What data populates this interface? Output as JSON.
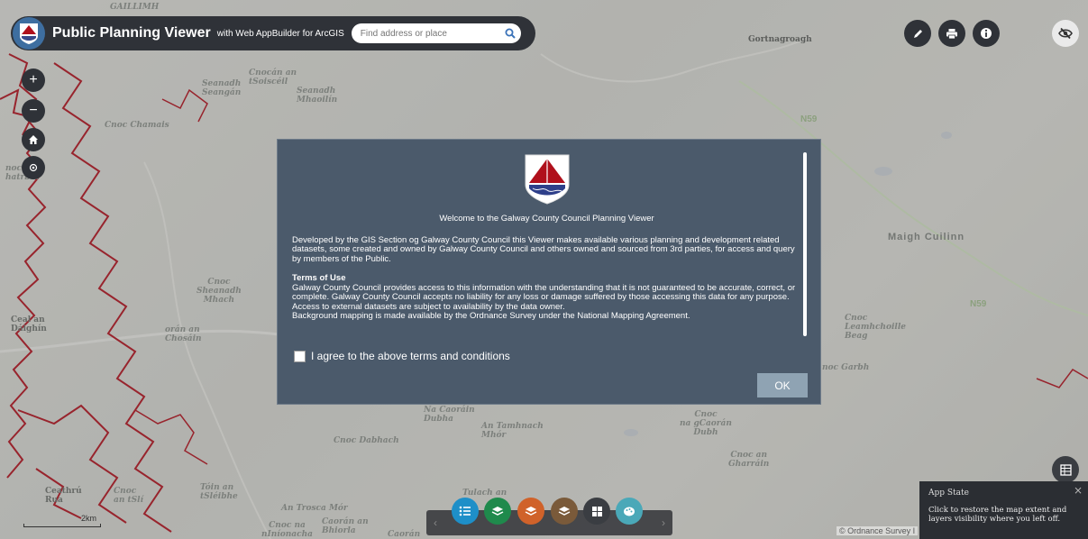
{
  "header": {
    "title": "Public Planning Viewer",
    "subtitle": "with Web AppBuilder for ArcGIS",
    "search_placeholder": "Find address or place"
  },
  "map_labels": [
    {
      "text": "GAILLIMH"
    },
    {
      "text": "Cnocán an\ntSoiscéil"
    },
    {
      "text": "Seanadh\nSeangán"
    },
    {
      "text": "Seanadh\nMhaoilín"
    },
    {
      "text": "Cnoc Chamais"
    },
    {
      "text": "Gortnagroagh"
    },
    {
      "text": "N59"
    },
    {
      "text": "Maigh Cuilinn"
    },
    {
      "text": "N59"
    },
    {
      "text": "Cnoc\nSheanadh\nMhach"
    },
    {
      "text": "Cnoc\nLeamhchoille\nBeag"
    },
    {
      "text": "noc Garbh"
    },
    {
      "text": "Na Caoráin\nDubha"
    },
    {
      "text": "An Tamhnach\nMhór"
    },
    {
      "text": "Cnoc\nna gCaorán\nDubh"
    },
    {
      "text": "Cnoc Dabhach"
    },
    {
      "text": "Cnoc an\nGharráin"
    },
    {
      "text": "Tóin an\ntSléibhe"
    },
    {
      "text": "Tulach an"
    },
    {
      "text": "An Trosca Mór"
    },
    {
      "text": "Cnoc na\nnIníonacha"
    },
    {
      "text": "Caorán an\nBhiorla"
    },
    {
      "text": "Caorán"
    },
    {
      "text": "Ceathrú\nRua"
    },
    {
      "text": "Cnoc\nan tSlí"
    },
    {
      "text": "Ceal an\nDáighín"
    },
    {
      "text": "orán an\nChosáin"
    },
    {
      "text": "noc\nhatrbui"
    }
  ],
  "dialog": {
    "welcome": "Welcome to the Galway County Council Planning Viewer",
    "intro": "Developed by the GIS Section og Galway County Council this Viewer makes available various planning and development related datasets, some created and owned by Galway County Council and others owned and sourced from 3rd parties, for access and query by members of the Public.",
    "terms_heading": "Terms of Use",
    "terms_1": "Galway County Council provides access to this information with the understanding that it is not guaranteed to be accurate, correct, or complete. Galway County Council accepts no liability for any loss or damage suffered by those accessing this data for any purpose.",
    "terms_2": "Access to external datasets are subject to availability by the data owner.",
    "terms_3": "Background mapping is made available by the Ordnance Survey under the National Mapping Agreement.",
    "agree_label": "I agree to the above terms and conditions",
    "ok_label": "OK"
  },
  "app_state": {
    "title": "App State",
    "text": "Click to restore the map extent and layers visibility where you left off.",
    "close": "×"
  },
  "scale_label": "2km",
  "copyright": "© Ordnance Survey I",
  "icons": {
    "zoom_in": "+",
    "zoom_out": "−",
    "prev": "‹",
    "next": "›"
  },
  "colors": {
    "header_bg": "#2f3238",
    "dialog_bg": "#4b5a6b",
    "boundary": "#b0101c",
    "ok_button": "#8fa3b3"
  }
}
